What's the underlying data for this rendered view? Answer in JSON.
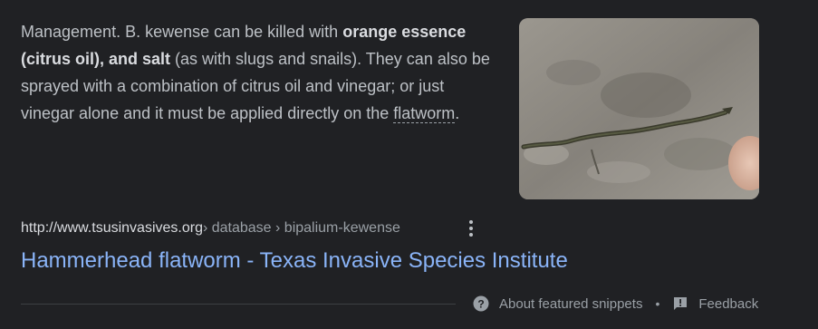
{
  "snippet": {
    "part1": "Management. B. kewense can be killed with ",
    "bold1": "orange essence (citrus oil), and salt",
    "part2": " (as with slugs and snails). They can also be sprayed with a combination of citrus oil and vinegar; or just vinegar alone and it must be applied directly on the ",
    "term": "flatworm",
    "part3": "."
  },
  "thumbnail": {
    "icon": "flatworm-photo"
  },
  "result": {
    "host": "http://www.tsusinvasives.org",
    "path": " › database › bipalium-kewense",
    "title": "Hammerhead flatworm - Texas Invasive Species Institute",
    "menu_icon": "more-vert-icon"
  },
  "footer": {
    "about_label": "About featured snippets",
    "separator": "•",
    "feedback_label": "Feedback",
    "about_icon": "help-circle-icon",
    "feedback_icon": "feedback-icon"
  },
  "colors": {
    "background": "#202124",
    "text": "#bdc1c6",
    "link": "#8ab4f8",
    "muted": "#9aa0a6"
  }
}
